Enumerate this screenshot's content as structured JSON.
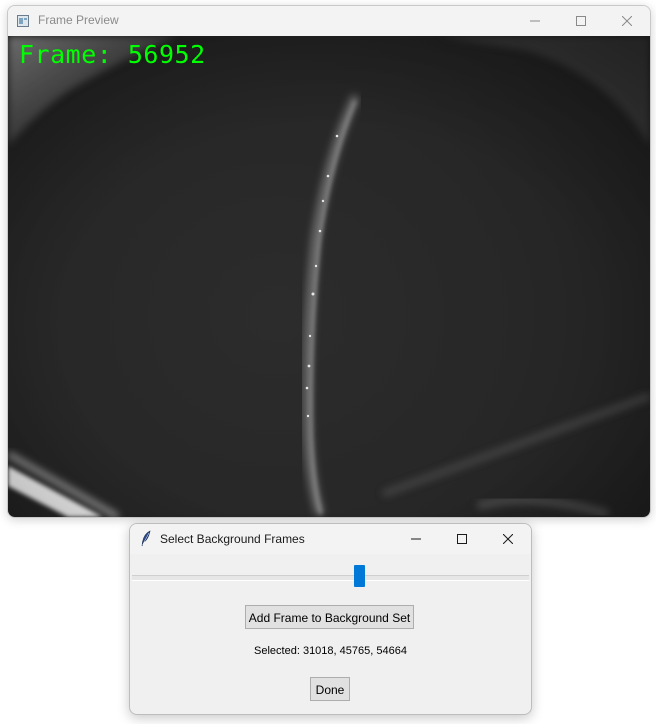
{
  "preview_window": {
    "title": "Frame Preview",
    "frame_label": "Frame: 56952",
    "frame_label_color": "#00ff00"
  },
  "dialog": {
    "title": "Select Background Frames",
    "slider_position": 0.575,
    "add_button_label": "Add Frame to Background Set",
    "selected_text": "Selected: 31018, 45765, 54664",
    "done_button_label": "Done",
    "accent_color": "#0078d7"
  }
}
